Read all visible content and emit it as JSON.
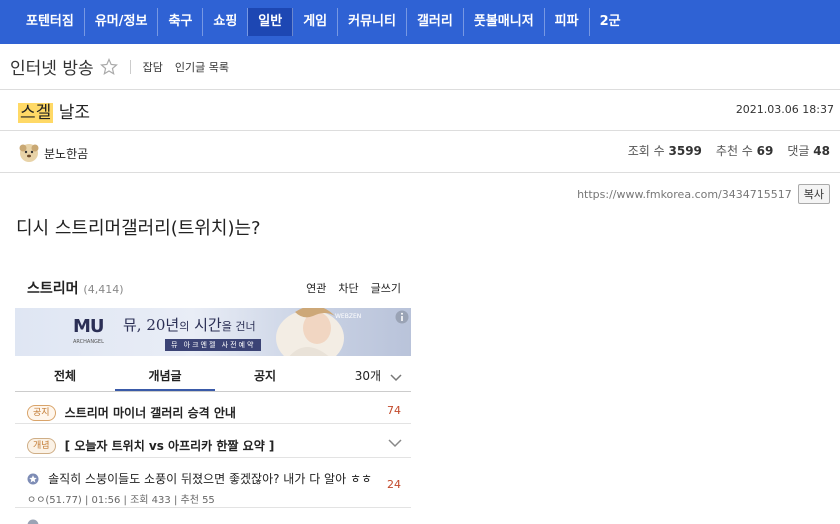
{
  "nav": {
    "items": [
      {
        "label": "포텐터짐",
        "active": false
      },
      {
        "label": "유머/정보",
        "active": false
      },
      {
        "label": "축구",
        "active": false
      },
      {
        "label": "쇼핑",
        "active": false
      },
      {
        "label": "일반",
        "active": true
      },
      {
        "label": "게임",
        "active": false
      },
      {
        "label": "커뮤니티",
        "active": false
      },
      {
        "label": "갤러리",
        "active": false
      },
      {
        "label": "풋볼매니저",
        "active": false
      },
      {
        "label": "피파",
        "active": false
      },
      {
        "label": "2군",
        "active": false
      }
    ],
    "color": "#2f62d4"
  },
  "board": {
    "title": "인터넷 방송",
    "links": [
      "잡담",
      "인기글 목록"
    ]
  },
  "post": {
    "title_highlight": "스겔",
    "title_rest": "날조",
    "date": "2021.03.06 18:37",
    "author": "분노한곰",
    "views_label": "조회 수",
    "views": "3599",
    "recommend_label": "추천 수",
    "recommend": "69",
    "comments_label": "댓글",
    "comments": "48",
    "url": "https://www.fmkorea.com/3434715517",
    "copy_label": "복사",
    "body": "디시 스트리머갤러리(트위치)는?"
  },
  "embed": {
    "title": "스트리머",
    "count": "(4,414)",
    "actions": [
      "연관",
      "차단",
      "글쓰기"
    ],
    "banner": {
      "logo": "MU",
      "logo_sub": "ARCHANGEL",
      "text_a": "뮤, 20년",
      "text_b": "의",
      "text_c": " 시간",
      "text_d": "을 건너",
      "sub": "뮤 아크엔젤 사전예약",
      "brand": "WEBZEN"
    },
    "tabs": [
      "전체",
      "개념글",
      "공지"
    ],
    "active_tab": 1,
    "list_count": "30개",
    "rows": [
      {
        "badge": "공지",
        "text": "스트리머 마이너 갤러리 승격 안내",
        "count": "74"
      },
      {
        "badge": "개념",
        "text": "[ 오늘자 트위치 vs 아프리카 한짤 요약 ]",
        "count": ""
      },
      {
        "text": "솔직히 스붕이들도 소풍이 뒤졌으면 좋겠잖아? 내가 다 알아 ㅎㅎ",
        "count": "24",
        "meta": "ㅇㅇ(51.77)  |  01:56  |  조회 433  |  추천 55"
      }
    ]
  }
}
